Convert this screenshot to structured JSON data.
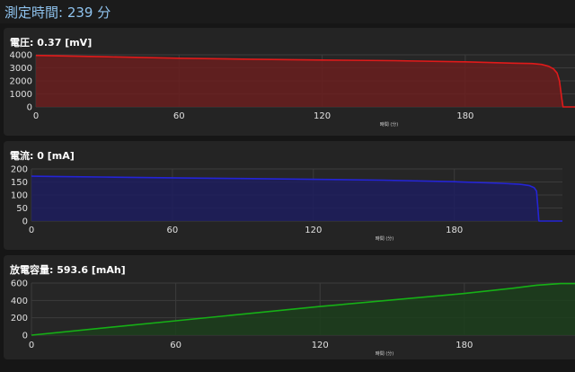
{
  "header": {
    "title": "測定時間: 239 分"
  },
  "panels": [
    {
      "title": "電圧: 0.37 [mV]"
    },
    {
      "title": "電流: 0 [mA]"
    },
    {
      "title": "放電容量: 593.6 [mAh]"
    }
  ],
  "chart_data": [
    {
      "type": "area",
      "title": "電圧: 0.37 [mV]",
      "xlabel": "時間 (分)",
      "ylabel": "",
      "xlim": [
        0,
        226
      ],
      "ylim": [
        0,
        4000
      ],
      "xticks": [
        0,
        60,
        120,
        180
      ],
      "yticks": [
        0,
        1000,
        2000,
        3000,
        4000
      ],
      "grid": true,
      "color": "#e01a1a",
      "fill": "#6a1e1e",
      "series": [
        {
          "x": [
            0,
            10,
            30,
            60,
            90,
            120,
            150,
            180,
            200,
            208,
            212,
            215,
            217,
            218.5,
            219.5,
            220.5,
            221,
            226
          ],
          "y": [
            3950,
            3920,
            3850,
            3740,
            3660,
            3600,
            3550,
            3460,
            3360,
            3330,
            3260,
            3120,
            2920,
            2600,
            2000,
            600,
            0,
            0
          ]
        }
      ]
    },
    {
      "type": "area",
      "title": "電流: 0 [mA]",
      "xlabel": "時間 (分)",
      "ylabel": "",
      "xlim": [
        0,
        226
      ],
      "ylim": [
        0,
        200
      ],
      "xticks": [
        0,
        60,
        120,
        180
      ],
      "yticks": [
        0,
        50,
        100,
        150,
        200
      ],
      "grid": true,
      "color": "#2424d6",
      "fill": "#1d1d5e",
      "series": [
        {
          "x": [
            0,
            10,
            30,
            60,
            90,
            120,
            150,
            180,
            200,
            208,
            212,
            214,
            215,
            215.5,
            216,
            226
          ],
          "y": [
            172,
            171,
            169,
            166,
            163,
            160,
            157,
            151,
            145,
            141,
            136,
            128,
            115,
            60,
            0,
            0
          ]
        }
      ]
    },
    {
      "type": "area",
      "title": "放電容量: 593.6 [mAh]",
      "xlabel": "時間 (分)",
      "ylabel": "",
      "xlim": [
        0,
        226
      ],
      "ylim": [
        0,
        600
      ],
      "xticks": [
        0,
        60,
        120,
        180
      ],
      "yticks": [
        0,
        200,
        400,
        600
      ],
      "grid": true,
      "color": "#16b016",
      "fill": "#1c3e1c",
      "series": [
        {
          "x": [
            0,
            60,
            120,
            180,
            200,
            210,
            220,
            226
          ],
          "y": [
            0,
            165,
            330,
            480,
            540,
            575,
            593.6,
            593.6
          ]
        }
      ]
    }
  ]
}
